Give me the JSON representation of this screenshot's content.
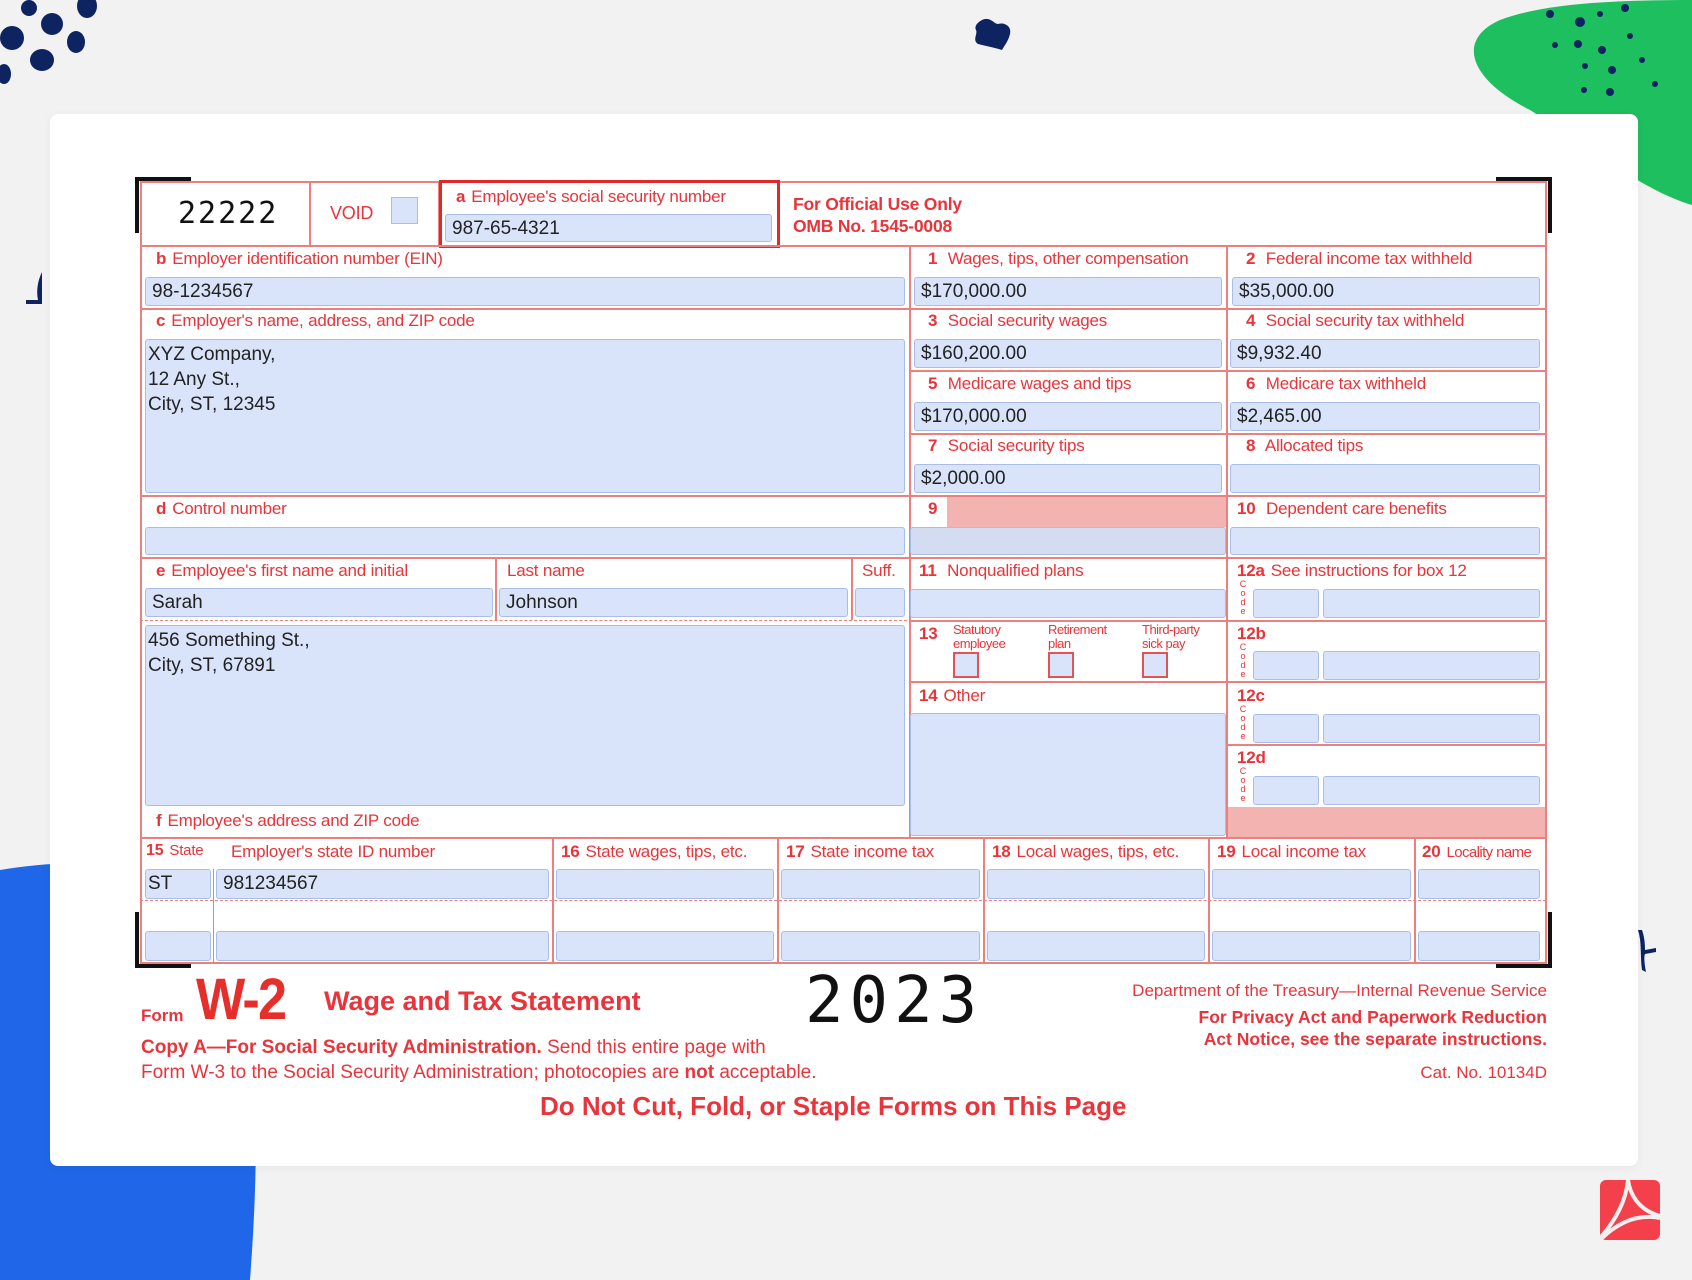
{
  "form": {
    "control_code": "22222",
    "void_label": "VOID",
    "box_a": {
      "letter": "a",
      "label": "Employee's social security number",
      "value": "987-65-4321"
    },
    "official_use": {
      "line1": "For Official Use Only",
      "line2": "OMB No. 1545-0008"
    },
    "box_b": {
      "letter": "b",
      "label": "Employer identification number (EIN)",
      "value": "98-1234567"
    },
    "box_c": {
      "letter": "c",
      "label": "Employer's name, address, and ZIP code",
      "value": "XYZ Company,\n12 Any St.,\nCity, ST, 12345"
    },
    "box_d": {
      "letter": "d",
      "label": "Control number",
      "value": ""
    },
    "box_e": {
      "letter": "e",
      "first_label": "Employee's first name and initial",
      "last_label": "Last name",
      "suff_label": "Suff.",
      "first": "Sarah",
      "last": "Johnson",
      "suff": ""
    },
    "box_f": {
      "letter": "f",
      "label": "Employee's address and ZIP code",
      "value": "456 Something St.,\nCity, ST, 67891"
    },
    "boxes": [
      {
        "num": "1",
        "label": "Wages, tips, other compensation",
        "value": "$170,000.00"
      },
      {
        "num": "2",
        "label": "Federal income tax withheld",
        "value": "$35,000.00"
      },
      {
        "num": "3",
        "label": "Social security wages",
        "value": "$160,200.00"
      },
      {
        "num": "4",
        "label": "Social security tax withheld",
        "value": "$9,932.40"
      },
      {
        "num": "5",
        "label": "Medicare wages and tips",
        "value": "$170,000.00"
      },
      {
        "num": "6",
        "label": "Medicare tax withheld",
        "value": "$2,465.00"
      },
      {
        "num": "7",
        "label": "Social security tips",
        "value": "$2,000.00"
      },
      {
        "num": "8",
        "label": "Allocated tips",
        "value": ""
      },
      {
        "num": "9",
        "label": "",
        "value": ""
      },
      {
        "num": "10",
        "label": "Dependent care benefits",
        "value": ""
      },
      {
        "num": "11",
        "label": "Nonqualified plans",
        "value": ""
      }
    ],
    "box_12": {
      "items": [
        {
          "num": "12a",
          "label": "See instructions for box 12",
          "code": "",
          "amount": ""
        },
        {
          "num": "12b",
          "label": "",
          "code": "",
          "amount": ""
        },
        {
          "num": "12c",
          "label": "",
          "code": "",
          "amount": ""
        },
        {
          "num": "12d",
          "label": "",
          "code": "",
          "amount": ""
        }
      ],
      "code_letters": [
        "C",
        "o",
        "d",
        "e"
      ]
    },
    "box_13": {
      "num": "13",
      "options": [
        {
          "line1": "Statutory",
          "line2": "employee",
          "checked": false
        },
        {
          "line1": "Retirement",
          "line2": "plan",
          "checked": false
        },
        {
          "line1": "Third-party",
          "line2": "sick pay",
          "checked": false
        }
      ]
    },
    "box_14": {
      "num": "14",
      "label": "Other",
      "value": ""
    },
    "state_headers": {
      "b15_num": "15",
      "b15_state": "State",
      "b15_id": "Employer's state ID number",
      "b16_num": "16",
      "b16": "State wages, tips, etc.",
      "b17_num": "17",
      "b17": "State income tax",
      "b18_num": "18",
      "b18": "Local wages, tips, etc.",
      "b19_num": "19",
      "b19": "Local income tax",
      "b20_num": "20",
      "b20": "Locality name"
    },
    "state_rows": [
      {
        "state": "ST",
        "id": "981234567",
        "state_wages": "",
        "state_tax": "",
        "local_wages": "",
        "local_tax": "",
        "locality": ""
      },
      {
        "state": "",
        "id": "",
        "state_wages": "",
        "state_tax": "",
        "local_wages": "",
        "local_tax": "",
        "locality": ""
      }
    ]
  },
  "footer": {
    "form_word": "Form",
    "form_name": "W-2",
    "title": "Wage and Tax Statement",
    "year": "2023",
    "dept": "Department of the Treasury—Internal Revenue Service",
    "privacy1": "For Privacy Act and Paperwork Reduction",
    "privacy2": "Act Notice, see the separate instructions.",
    "copy_bold": "Copy A—For Social Security Administration.",
    "copy_rest1": " Send this entire page with",
    "copy_line2a": "Form W-3 to the Social Security Administration; photocopies are ",
    "copy_not": "not",
    "copy_line2b": " acceptable.",
    "cat": "Cat. No. 10134D",
    "warning": "Do Not Cut, Fold, or Staple Forms on This Page"
  },
  "app": {
    "pdf_icon": "acrobat-pdf-icon"
  },
  "colors": {
    "form_red": "#e8343a",
    "field_blue": "#d9e4fb",
    "shaded_pink": "#f3b3b1",
    "deco_green": "#1dbf5e",
    "deco_blue": "#1f67e8",
    "deco_navy": "#0d2460"
  }
}
